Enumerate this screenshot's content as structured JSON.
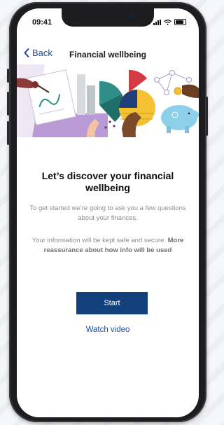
{
  "status_bar": {
    "time": "09:41"
  },
  "nav": {
    "back_label": "Back",
    "title": "Financial wellbeing"
  },
  "main": {
    "headline": "Let’s discover your financial wellbeing",
    "intro": "To get started we’re going to ask you a few questions about your finances.",
    "reassurance_text": "Your information will be kept safe and secure.",
    "reassurance_link": "More reassurance about how info will be used",
    "start_label": "Start",
    "watch_video_label": "Watch video"
  },
  "colors": {
    "primary": "#143f7d",
    "link": "#1a4e9a",
    "illustration_purple": "#b99ad6",
    "illustration_teal": "#2f8f88",
    "illustration_yellow": "#f4c233",
    "illustration_red": "#d33a43",
    "illustration_sky": "#8ecfe9"
  }
}
